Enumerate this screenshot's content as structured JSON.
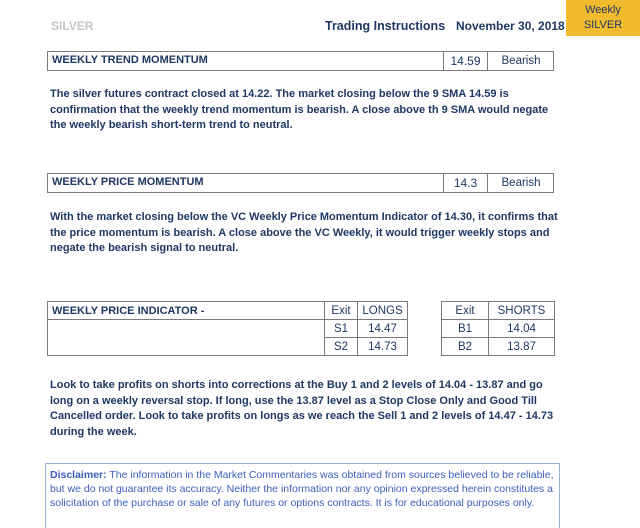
{
  "header": {
    "commodity": "SILVER",
    "title": "Trading Instructions",
    "date": "November 30, 2018",
    "badge": [
      "Weekly",
      "SILVER"
    ]
  },
  "trend": {
    "label": "WEEKLY TREND MOMENTUM",
    "value": "14.59",
    "signal": "Bearish",
    "text": "The silver futures contract closed at 14.22. The market closing below the 9 SMA 14.59 is confirmation that the weekly trend momentum is bearish. A close above th 9 SMA would negate the weekly bearish short-term trend to neutral."
  },
  "price": {
    "label": "WEEKLY PRICE MOMENTUM",
    "value": "14.3",
    "signal": "Bearish",
    "text": "With the market closing below the VC Weekly Price Momentum Indicator of 14.30, it confirms that the price momentum is bearish. A close above the VC Weekly, it would trigger weekly stops and negate the bearish signal to neutral."
  },
  "indicator": {
    "label": "WEEKLY PRICE INDICATOR -",
    "longs": {
      "headers": [
        "Exit",
        "LONGS"
      ],
      "rows": [
        [
          "S1",
          "14.47"
        ],
        [
          "S2",
          "14.73"
        ]
      ]
    },
    "shorts": {
      "headers": [
        "Exit",
        "SHORTS"
      ],
      "rows": [
        [
          "B1",
          "14.04"
        ],
        [
          "B2",
          "13.87"
        ]
      ]
    },
    "text": "Look to take profits on shorts into corrections at the Buy 1 and 2 levels of 14.04 - 13.87 and go long on a weekly reversal stop. If long, use the 13.87 level as a Stop Close Only and Good Till Cancelled order. Look to take profits on longs as we reach the Sell 1 and 2 levels of 14.47 - 14.73 during the week."
  },
  "disclaimer": {
    "label": "Disclaimer:",
    "text": "The information in the Market Commentaries was obtained from sources believed to be reliable, but we do not guarantee its accuracy. Neither the information nor any opinion expressed herein constitutes a solicitation of the purchase or sale of any futures or options contracts. It is for educational purposes only."
  }
}
